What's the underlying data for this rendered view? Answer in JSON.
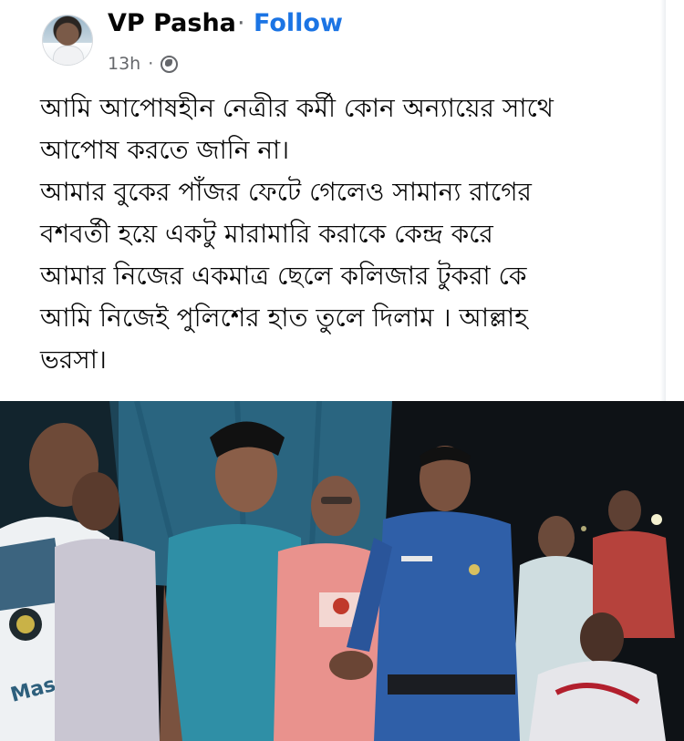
{
  "post": {
    "author": "VP Pasha",
    "separator": "·",
    "follow_label": "Follow",
    "time": "13h",
    "meta_separator": "·",
    "audience_icon": "globe-icon",
    "text_lines": [
      "আমি আপোষহীন  নেত্রীর কর্মী কোন অন্যায়ের সাথে",
      "আপোষ করতে জানি না।",
      "আমার বুকের পাঁজর ফেটে গেলেও সামান্য রাগের",
      "বশবর্তী হয়ে একটু মারামারি   করাকে কেন্দ্র করে",
      "আমার নিজের একমাত্র ছেলে কলিজার টুকরা কে",
      "আমি নিজেই পুলিশের হাত তুলে দিলাম । আল্লাহ",
      "ভরসা।"
    ]
  },
  "photo": {
    "shirt_text": "Masud Tele",
    "colors": {
      "tarp": "#2d6f8c",
      "teal_shirt": "#2f8fa6",
      "pink_shirt": "#e9928d",
      "police_uniform": "#2f5fa8",
      "night": "#0e1216"
    }
  },
  "colors": {
    "link_blue": "#1b74e4",
    "meta_gray": "#65676b",
    "text": "#050505"
  }
}
